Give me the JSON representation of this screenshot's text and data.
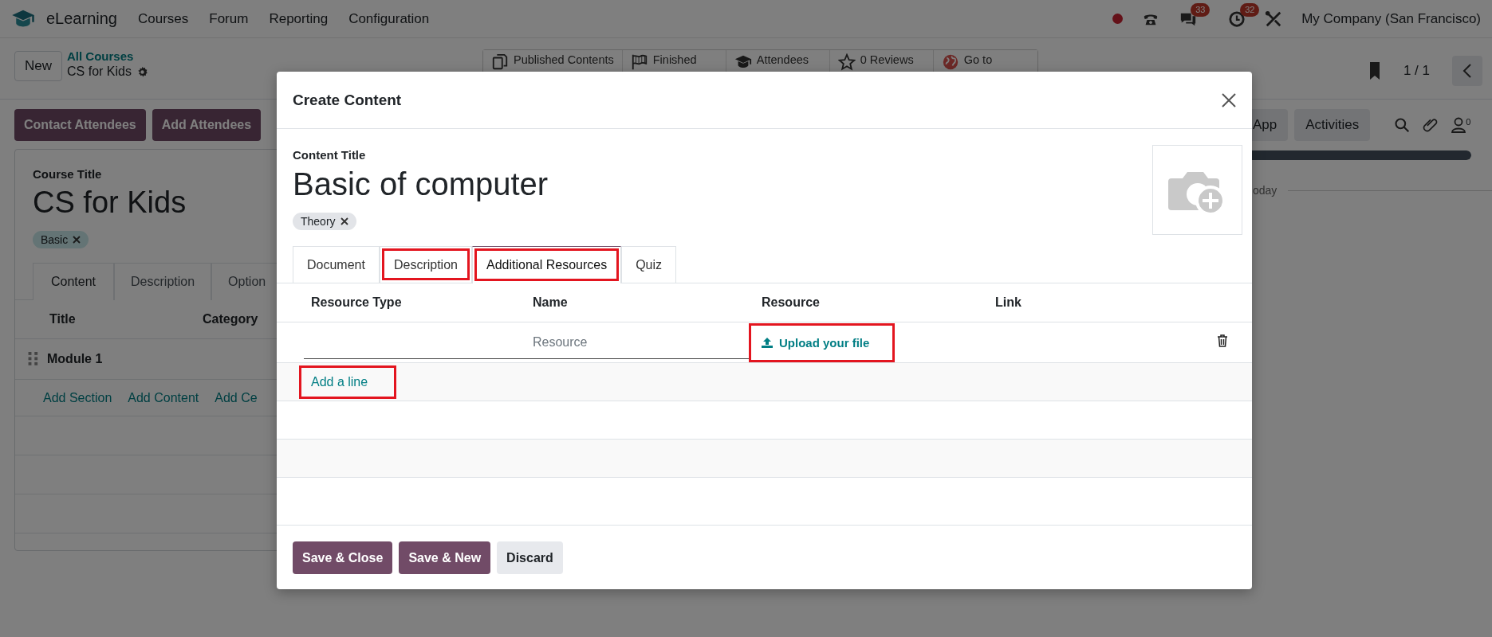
{
  "topbar": {
    "app_name": "eLearning",
    "menu": [
      "Courses",
      "Forum",
      "Reporting",
      "Configuration"
    ],
    "messages_badge": "33",
    "activities_badge": "32",
    "company": "My Company (San Francisco)"
  },
  "control_panel": {
    "new_button": "New",
    "breadcrumb_parent": "All Courses",
    "breadcrumb_current": "CS for Kids",
    "stat_buttons": [
      {
        "label": "Published Contents",
        "kind": "document"
      },
      {
        "label": "Finished",
        "kind": "flag"
      },
      {
        "label": "Attendees",
        "kind": "cap"
      },
      {
        "label": "0 Reviews",
        "kind": "star"
      },
      {
        "label": "Go to",
        "kind": "globe"
      }
    ],
    "pager": "1 / 1"
  },
  "actions": {
    "buttons": [
      "Contact Attendees",
      "Add Attendees"
    ],
    "chatter_buttons": [
      "App",
      "Activities"
    ],
    "followers_count": "0"
  },
  "course": {
    "title_label": "Course Title",
    "title": "CS for Kids",
    "tags": [
      "Basic"
    ],
    "tabs": [
      {
        "label": "Content",
        "selected": true
      },
      {
        "label": "Description",
        "selected": false
      },
      {
        "label": "Option",
        "selected": false
      }
    ],
    "columns": [
      "Title",
      "Category"
    ],
    "sections": [
      "Module 1"
    ],
    "add_links": [
      "Add Section",
      "Add Content",
      "Add Ce"
    ]
  },
  "chatter": {
    "progress": {
      "level": 1
    },
    "date_separator": "oday"
  },
  "dialog": {
    "title": "Create Content",
    "content_title_label": "Content Title",
    "content_title": "Basic of computer",
    "tags": [
      "Theory"
    ],
    "tabs": [
      {
        "label": "Document",
        "selected": false,
        "highlighted": false
      },
      {
        "label": "Description",
        "selected": false,
        "highlighted": true
      },
      {
        "label": "Additional Resources",
        "selected": true,
        "highlighted": true
      },
      {
        "label": "Quiz",
        "selected": false,
        "highlighted": false
      }
    ],
    "columns": [
      "Resource Type",
      "Name",
      "Resource",
      "Link"
    ],
    "rows": [
      {
        "resource_type": "",
        "name_placeholder": "Resource",
        "resource": {
          "label": "Upload your file",
          "highlighted": true
        }
      }
    ],
    "add_line": {
      "label": "Add a line",
      "highlighted": true
    },
    "buttons": [
      {
        "label": "Save & Close",
        "kind": "primary"
      },
      {
        "label": "Save & New",
        "kind": "primary"
      },
      {
        "label": "Discard",
        "kind": "secondary"
      }
    ]
  }
}
